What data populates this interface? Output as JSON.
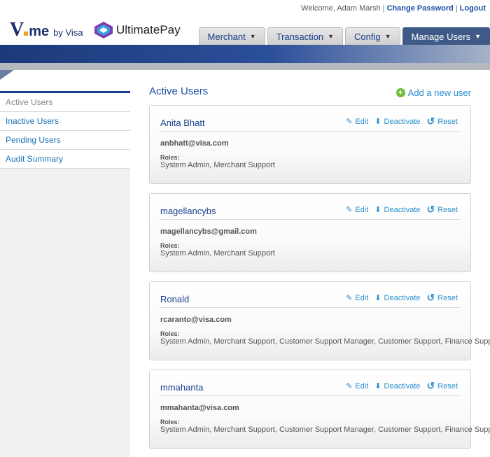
{
  "header": {
    "welcome": "Welcome, Adam Marsh",
    "change_password": "Change Password",
    "logout": "Logout",
    "logo_vme_v": "V",
    "logo_vme_me": "me",
    "logo_vme_byvisa": "by Visa",
    "logo_ultimatepay": "UltimatePay",
    "logo_ultimatepay_mark": "."
  },
  "nav": {
    "tabs": [
      {
        "label": "Merchant",
        "active": false
      },
      {
        "label": "Transaction",
        "active": false
      },
      {
        "label": "Config",
        "active": false
      },
      {
        "label": "Manage Users",
        "active": true
      }
    ]
  },
  "sidebar": {
    "items": [
      {
        "label": "Active Users",
        "active": true
      },
      {
        "label": "Inactive Users",
        "active": false
      },
      {
        "label": "Pending Users",
        "active": false
      },
      {
        "label": "Audit Summary",
        "active": false
      }
    ]
  },
  "main": {
    "title": "Active Users",
    "add_user_label": "Add a new user",
    "actions": {
      "edit": "Edit",
      "deactivate": "Deactivate",
      "reset": "Reset"
    },
    "roles_label": "Roles:",
    "users": [
      {
        "name": "Anita Bhatt",
        "email": "anbhatt@visa.com",
        "roles": "System Admin, Merchant Support"
      },
      {
        "name": "magellancybs",
        "email": "magellancybs@gmail.com",
        "roles": "System Admin, Merchant Support"
      },
      {
        "name": "Ronald",
        "email": "rcaranto@visa.com",
        "roles": "System Admin, Merchant Support, Customer Support Manager, Customer Support, Finance Support"
      },
      {
        "name": "mmahanta",
        "email": "mmahanta@visa.com",
        "roles": "System Admin, Merchant Support, Customer Support Manager, Customer Support, Finance Support"
      }
    ]
  },
  "colors": {
    "brand_navy": "#1a2e6b",
    "link_blue": "#2a8fd0",
    "nav_active": "#3f5a86",
    "add_green": "#6dbb3a"
  }
}
